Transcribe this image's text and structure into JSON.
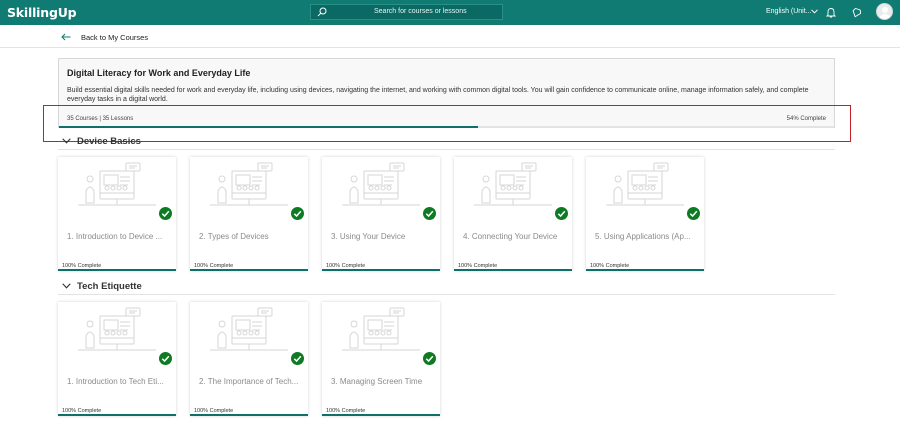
{
  "header": {
    "logo": "SkillingUp",
    "search_placeholder": "Search for courses or lessons",
    "language": "English (Unit..."
  },
  "back_label": "Back to My Courses",
  "course": {
    "title": "Digital Literacy for Work and Everyday Life",
    "description": "Build essential digital skills needed for work and everyday life, including using devices, navigating the internet, and working with common digital tools. You will gain confidence to communicate online, manage information safely, and complete everyday tasks in a digital world.",
    "counts": "35 Courses | 35 Lessons",
    "progress_label": "54% Complete",
    "progress": 0.54
  },
  "sections": [
    {
      "label": "Device Basics",
      "tiles": [
        {
          "title": "1. Introduction to Device ...",
          "status": "100% Complete"
        },
        {
          "title": "2. Types of Devices",
          "status": "100% Complete"
        },
        {
          "title": "3. Using Your Device",
          "status": "100% Complete"
        },
        {
          "title": "4. Connecting Your Device",
          "status": "100% Complete"
        },
        {
          "title": "5. Using Applications (Ap...",
          "status": "100% Complete"
        }
      ]
    },
    {
      "label": "Tech Etiquette",
      "tiles": [
        {
          "title": "1. Introduction to Tech Eti...",
          "status": "100% Complete"
        },
        {
          "title": "2. The Importance of Tech...",
          "status": "100% Complete"
        },
        {
          "title": "3. Managing Screen Time",
          "status": "100% Complete"
        }
      ]
    }
  ],
  "colors": {
    "brand": "#0f7b73",
    "progress": "#0f6f69",
    "check": "#0e7a23",
    "highlight": "#c32027"
  },
  "icons": [
    "search-icon",
    "chevron-down-icon",
    "bell-icon",
    "badge-icon",
    "avatar-icon",
    "back-arrow-icon",
    "checkmark-icon"
  ]
}
